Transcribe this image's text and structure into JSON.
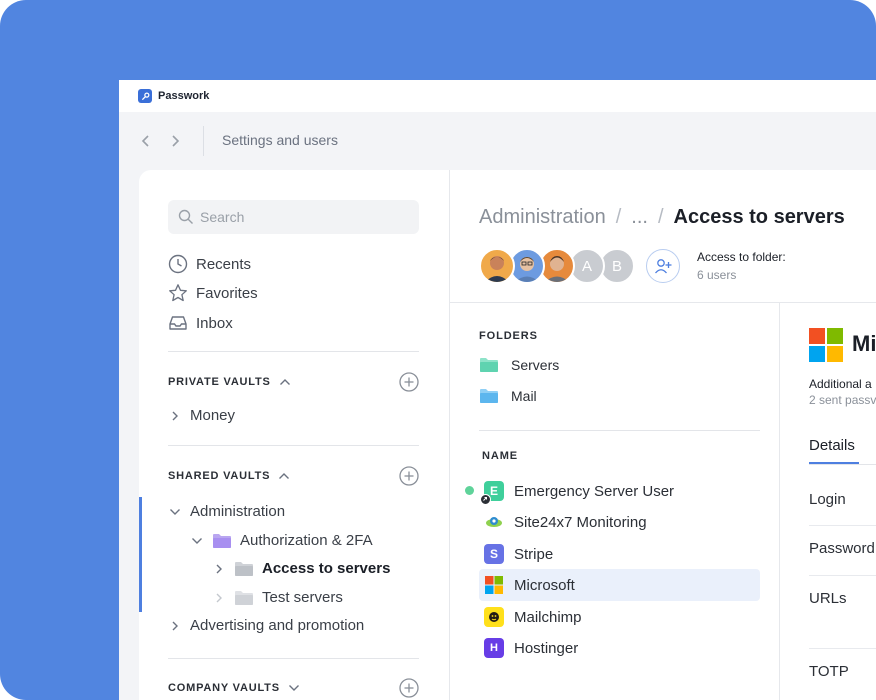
{
  "app": {
    "title": "Passwork"
  },
  "navbar": {
    "title": "Settings and users"
  },
  "sidebar": {
    "search_placeholder": "Search",
    "menu": [
      {
        "label": "Recents",
        "icon": "clock-icon"
      },
      {
        "label": "Favorites",
        "icon": "star-icon"
      },
      {
        "label": "Inbox",
        "icon": "inbox-icon"
      }
    ],
    "private_vaults": {
      "label": "PRIVATE VAULTS",
      "items": [
        "Money"
      ]
    },
    "shared_vaults": {
      "label": "SHARED VAULTS",
      "items": [
        "Administration",
        "Authorization & 2FA",
        "Access to servers",
        "Test servers",
        "Advertising and promotion"
      ]
    },
    "company_vaults": {
      "label": "COMPANY VAULTS"
    }
  },
  "main": {
    "breadcrumb": {
      "root": "Administration",
      "ellipsis": "...",
      "current": "Access to servers"
    },
    "avatars": [
      {
        "type": "photo",
        "color": "#f0a94a"
      },
      {
        "type": "photo",
        "color": "#5a8fd6"
      },
      {
        "type": "photo",
        "color": "#e68a3c"
      },
      {
        "type": "letter",
        "letter": "A"
      },
      {
        "type": "letter",
        "letter": "B"
      }
    ],
    "access": {
      "label": "Access to folder:",
      "count": "6 users"
    },
    "folders": {
      "heading": "FOLDERS",
      "items": [
        {
          "label": "Servers",
          "color": "#5fd3b0"
        },
        {
          "label": "Mail",
          "color": "#5cb6ee"
        }
      ]
    },
    "items": {
      "heading": "NAME",
      "rows": [
        {
          "label": "Emergency Server User",
          "icon": "letter-e-icon",
          "color": "#3fcf9b",
          "glyph": "E"
        },
        {
          "label": "Site24x7 Monitoring",
          "icon": "site24x7-icon",
          "color": "#ffffff",
          "glyph": ""
        },
        {
          "label": "Stripe",
          "icon": "stripe-icon",
          "color": "#6772e5",
          "glyph": "S"
        },
        {
          "label": "Microsoft",
          "icon": "microsoft-icon",
          "color": "#ffffff",
          "glyph": ""
        },
        {
          "label": "Mailchimp",
          "icon": "mailchimp-icon",
          "color": "#ffe01b",
          "glyph": ""
        },
        {
          "label": "Hostinger",
          "icon": "hostinger-icon",
          "color": "#673de6",
          "glyph": "H"
        }
      ],
      "selected_index": 3
    }
  },
  "detail": {
    "name": "Mi",
    "additional": "Additional a",
    "sent": "2 sent passv",
    "tab": "Details",
    "fields": [
      "Login",
      "Password",
      "URLs",
      "TOTP"
    ]
  },
  "colors": {
    "accent": "#4e7fe0",
    "background": "#5185e0"
  }
}
